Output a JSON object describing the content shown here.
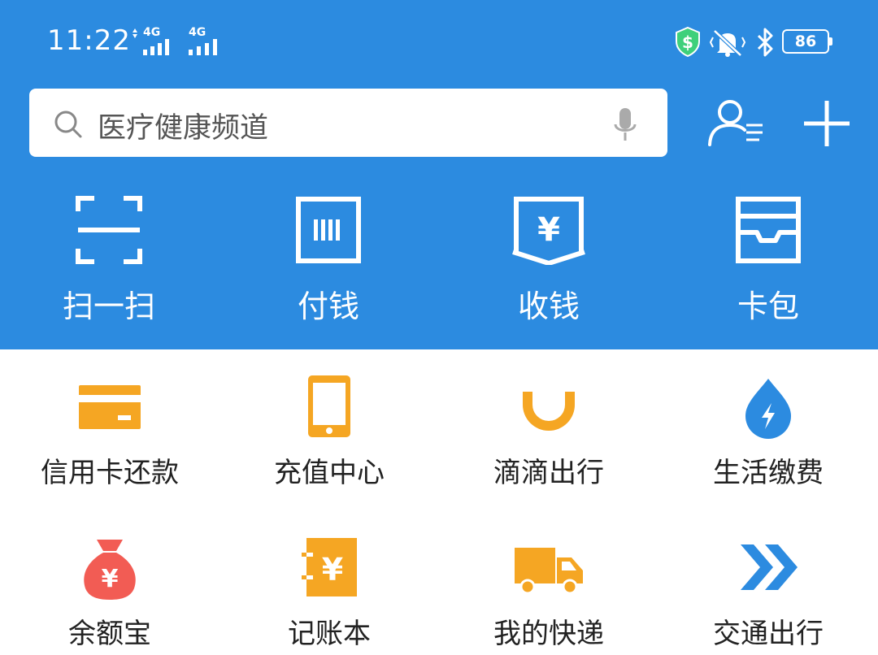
{
  "status_bar": {
    "time": "11:22",
    "net1": "4G",
    "net2": "4G",
    "battery": "86"
  },
  "search": {
    "placeholder": "医疗健康频道"
  },
  "header_actions": {
    "contacts_icon": "person-list-icon",
    "add_icon": "plus-icon"
  },
  "quick_actions": [
    {
      "label": "扫一扫",
      "icon": "scan-icon"
    },
    {
      "label": "付钱",
      "icon": "barcode-icon"
    },
    {
      "label": "收钱",
      "icon": "yen-pocket-icon"
    },
    {
      "label": "卡包",
      "icon": "card-wallet-icon"
    }
  ],
  "services": [
    {
      "label": "信用卡还款",
      "icon": "credit-card-icon"
    },
    {
      "label": "充值中心",
      "icon": "phone-icon"
    },
    {
      "label": "滴滴出行",
      "icon": "didi-icon"
    },
    {
      "label": "生活缴费",
      "icon": "water-drop-icon"
    },
    {
      "label": "余额宝",
      "icon": "money-bag-icon"
    },
    {
      "label": "记账本",
      "icon": "ledger-icon"
    },
    {
      "label": "我的快递",
      "icon": "truck-icon"
    },
    {
      "label": "交通出行",
      "icon": "arrows-icon"
    }
  ],
  "colors": {
    "brand_blue": "#2c8be0",
    "orange": "#f5a623",
    "red": "#f25c54",
    "blue_icon": "#2c8be0"
  }
}
